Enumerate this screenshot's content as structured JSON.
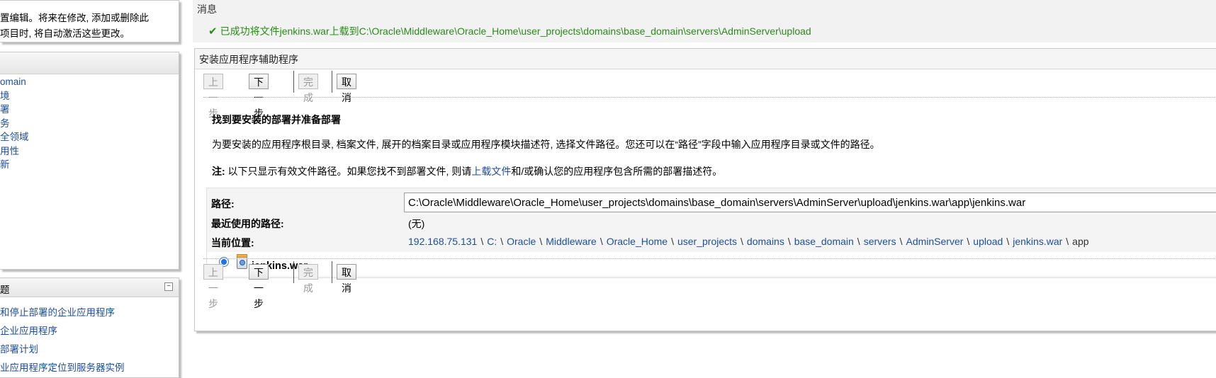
{
  "change_center": {
    "line1": "置编辑。将来在修改, 添加或删除此",
    "line2": "项目时, 将自动激活这些更改。"
  },
  "domain_structure": {
    "items": [
      "omain",
      "境",
      "署",
      "务",
      "全领域",
      "用性",
      "新"
    ]
  },
  "help_topics": {
    "title": "题",
    "collapse_icon": "minus-box-icon",
    "links": [
      "和停止部署的企业应用程序",
      "企业应用程序",
      "部署计划",
      "业应用程序定位到服务器实例"
    ]
  },
  "messages": {
    "label": "消息",
    "success_icon": "check-icon",
    "text": "已成功将文件jenkins.war上载到C:\\Oracle\\Middleware\\Oracle_Home\\user_projects\\domains\\base_domain\\servers\\AdminServer\\upload"
  },
  "wizard": {
    "title": "安装应用程序辅助程序",
    "buttons": {
      "back": "上一步",
      "next": "下一步",
      "finish": "完成",
      "cancel": "取消"
    },
    "heading": "找到要安装的部署并准备部署",
    "instructions": "为要安装的应用程序根目录, 档案文件, 展开的档案目录或应用程序模块描述符, 选择文件路径。您还可以在“路径”字段中输入应用程序目录或文件的路径。",
    "note_label": "注:",
    "note_before": " 以下只显示有效文件路径。如果您找不到部署文件, 则请",
    "note_link": "上载文件",
    "note_after": "和/或确认您的应用程序包含所需的部署描述符。",
    "path_label": "路径:",
    "path_value": "C:\\Oracle\\Middleware\\Oracle_Home\\user_projects\\domains\\base_domain\\servers\\AdminServer\\upload\\jenkins.war\\app\\jenkins.war",
    "recent_label": "最近使用的路径:",
    "recent_value": "(无)",
    "current_label": "当前位置:",
    "breadcrumb": [
      "192.168.75.131",
      "C:",
      "Oracle",
      "Middleware",
      "Oracle_Home",
      "user_projects",
      "domains",
      "base_domain",
      "servers",
      "AdminServer",
      "upload",
      "jenkins.war"
    ],
    "breadcrumb_last": "app",
    "breadcrumb_separator": "\\",
    "file_name": "jenkins.war"
  }
}
